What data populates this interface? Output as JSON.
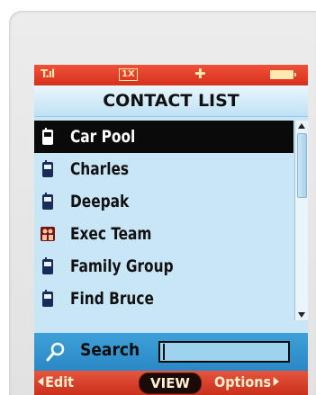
{
  "status_bar": {
    "signal": "T.ıl",
    "network": "1X",
    "location": "✚",
    "battery": "full"
  },
  "title": "CONTACT LIST",
  "contacts": [
    {
      "name": "Car Pool",
      "icon": "phone-icon",
      "selected": true
    },
    {
      "name": "Charles",
      "icon": "phone-icon",
      "selected": false
    },
    {
      "name": "Deepak",
      "icon": "phone-icon",
      "selected": false
    },
    {
      "name": "Exec Team",
      "icon": "group-icon",
      "selected": false
    },
    {
      "name": "Family Group",
      "icon": "phone-icon",
      "selected": false
    },
    {
      "name": "Find Bruce",
      "icon": "phone-icon",
      "selected": false
    }
  ],
  "search": {
    "label": "Search",
    "value": ""
  },
  "softkeys": {
    "left": "Edit",
    "center": "VIEW",
    "right": "Options"
  },
  "colors": {
    "header_red": "#d8301c",
    "screen_blue": "#c9e6f7",
    "search_blue": "#2a88c6",
    "selected_row": "#0a0a0a"
  }
}
